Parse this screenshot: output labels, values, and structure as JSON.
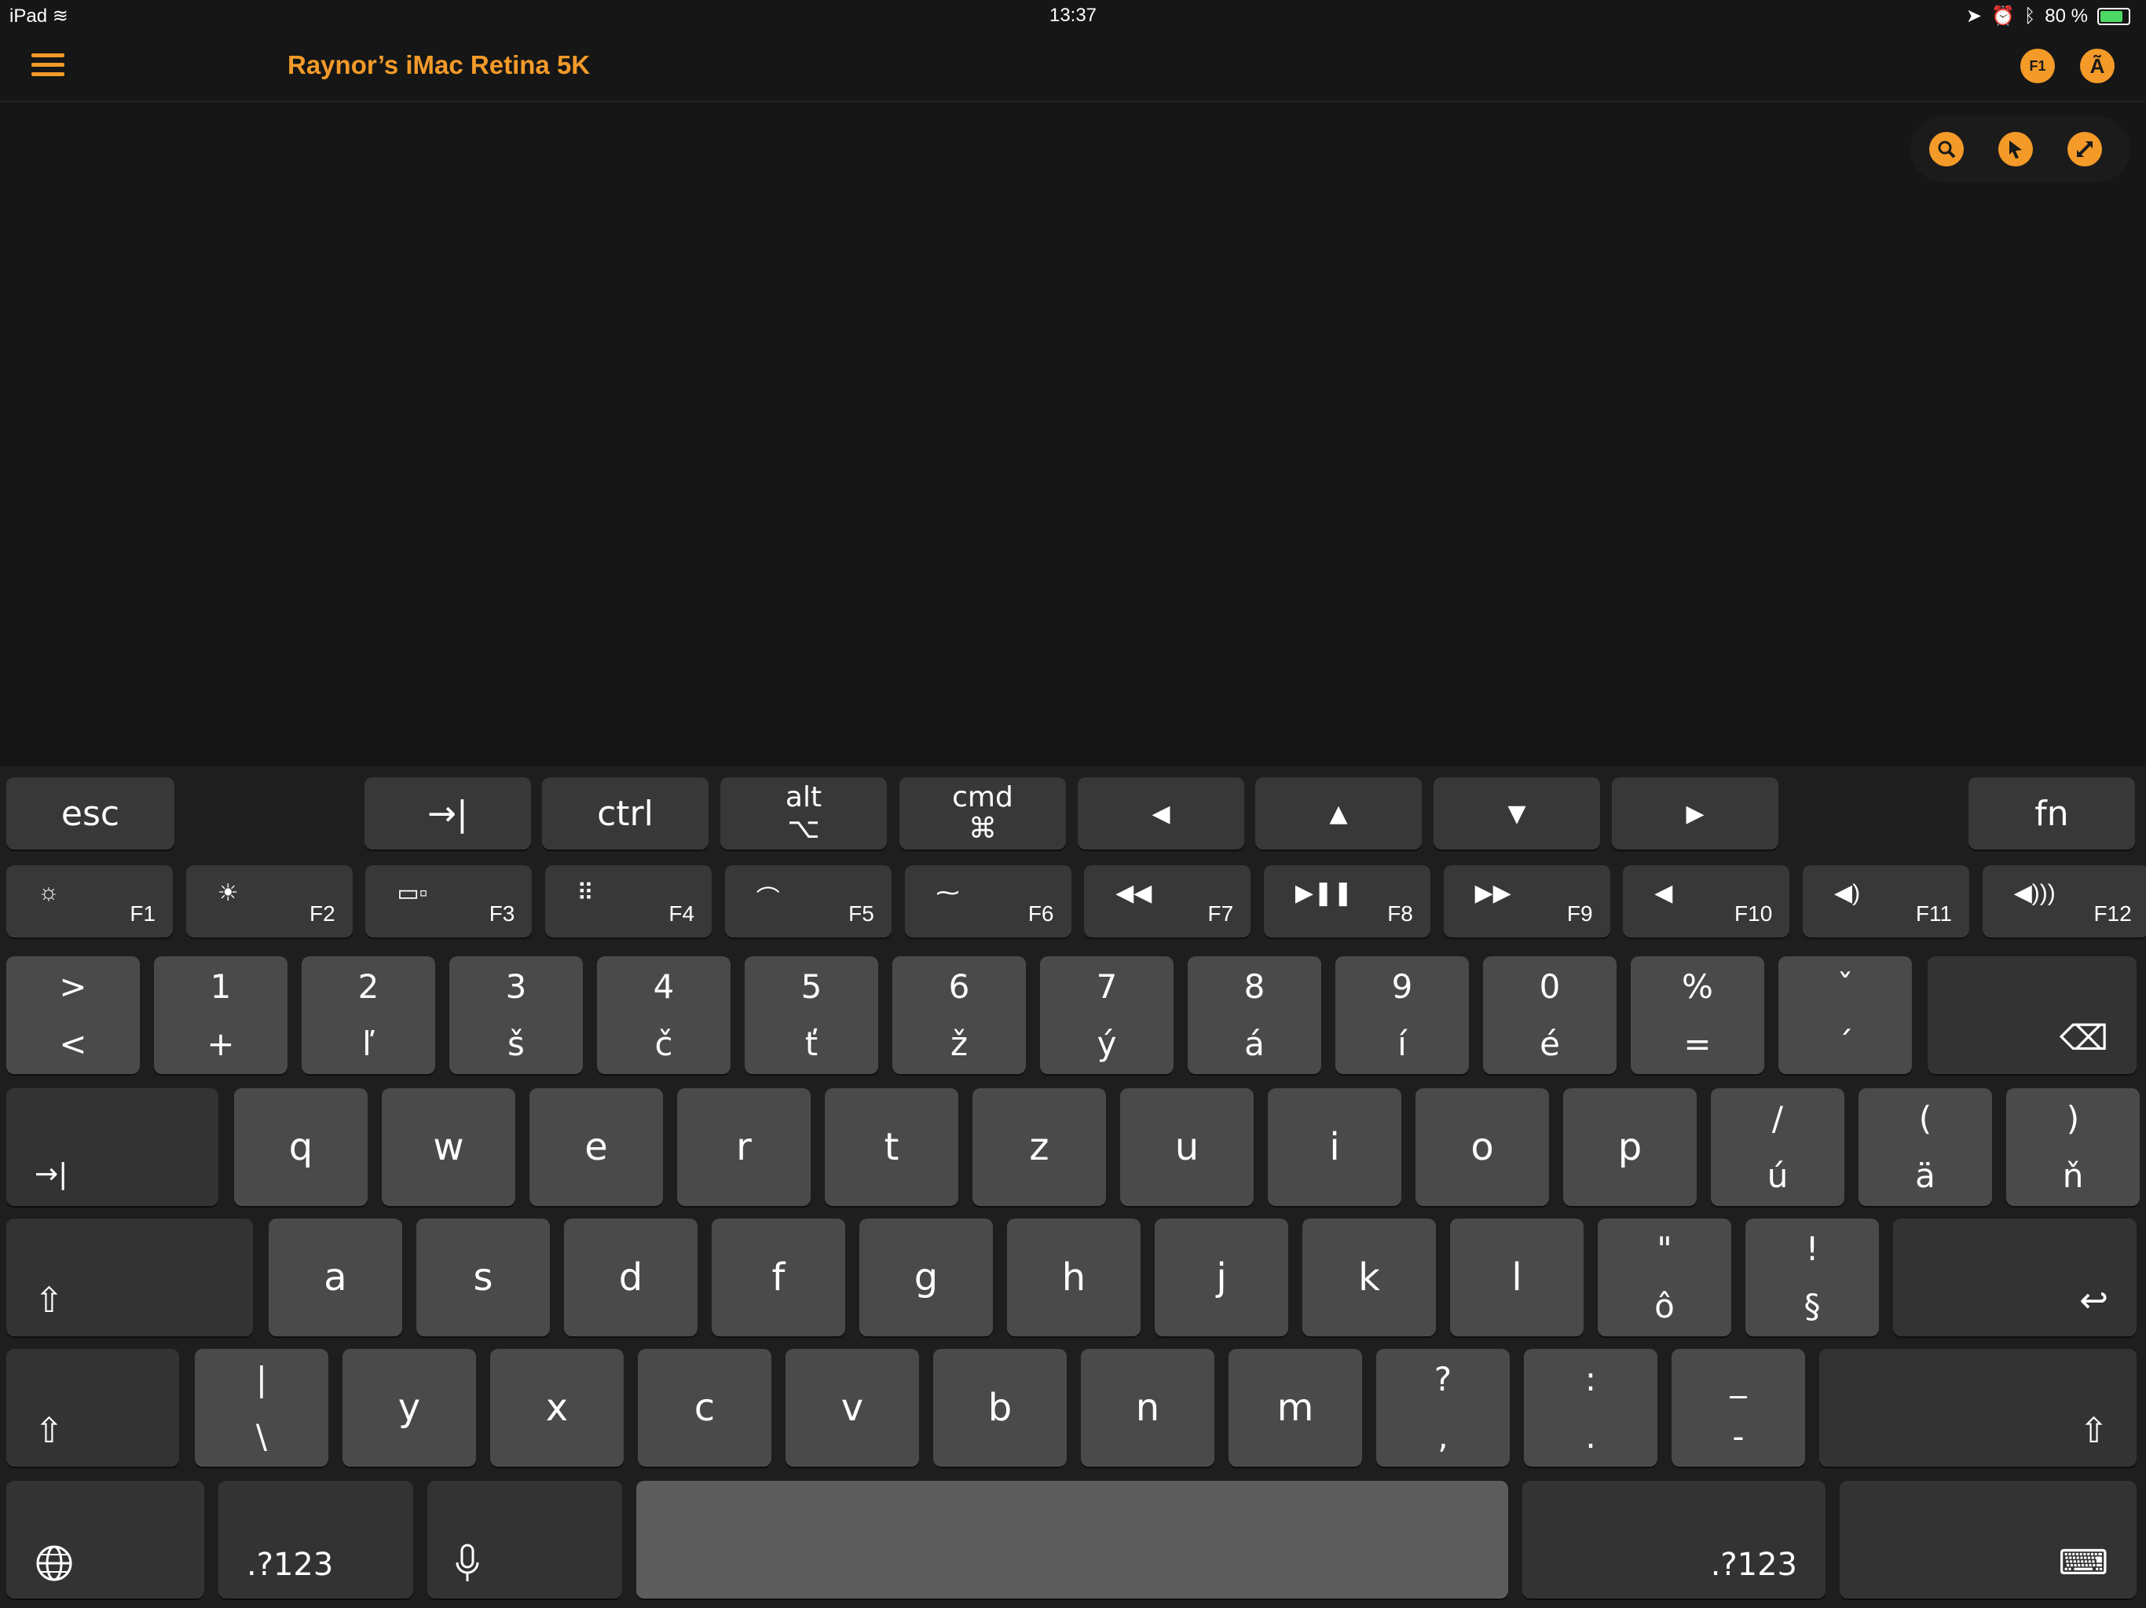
{
  "status": {
    "device": "iPad",
    "time": "13:37",
    "battery": "80 %",
    "battery_level": 0.8
  },
  "nav": {
    "title": "Raynor’s iMac Retina 5K",
    "f_label": "F1"
  },
  "mods": {
    "esc": "esc",
    "ctrl": "ctrl",
    "alt": "alt",
    "alt_sym": "⌥",
    "cmd": "cmd",
    "cmd_sym": "⌘",
    "fn": "fn",
    "left": "◀",
    "up": "▲",
    "down": "▼",
    "right": "▶",
    "tab": "→|"
  },
  "fkeys": [
    {
      "label": "F1",
      "icon": "brightness-down-icon",
      "glyph": "☼"
    },
    {
      "label": "F2",
      "icon": "brightness-up-icon",
      "glyph": "☀"
    },
    {
      "label": "F3",
      "icon": "mission-control-icon",
      "glyph": "▭▫"
    },
    {
      "label": "F4",
      "icon": "launchpad-icon",
      "glyph": "⠿"
    },
    {
      "label": "F5",
      "icon": "keyboard-light-down-icon",
      "glyph": "⌒"
    },
    {
      "label": "F6",
      "icon": "keyboard-light-up-icon",
      "glyph": "⁓"
    },
    {
      "label": "F7",
      "icon": "rewind-icon",
      "glyph": "◀◀"
    },
    {
      "label": "F8",
      "icon": "play-pause-icon",
      "glyph": "▶❚❚"
    },
    {
      "label": "F9",
      "icon": "fast-forward-icon",
      "glyph": "▶▶"
    },
    {
      "label": "F10",
      "icon": "mute-icon",
      "glyph": "◀"
    },
    {
      "label": "F11",
      "icon": "volume-down-icon",
      "glyph": "◀)"
    },
    {
      "label": "F12",
      "icon": "volume-up-icon",
      "glyph": "◀)))"
    }
  ],
  "row1": [
    {
      "top": ">",
      "bot": "<"
    },
    {
      "top": "1",
      "bot": "+"
    },
    {
      "top": "2",
      "bot": "ľ"
    },
    {
      "top": "3",
      "bot": "š"
    },
    {
      "top": "4",
      "bot": "č"
    },
    {
      "top": "5",
      "bot": "ť"
    },
    {
      "top": "6",
      "bot": "ž"
    },
    {
      "top": "7",
      "bot": "ý"
    },
    {
      "top": "8",
      "bot": "á"
    },
    {
      "top": "9",
      "bot": "í"
    },
    {
      "top": "0",
      "bot": "é"
    },
    {
      "top": "%",
      "bot": "="
    },
    {
      "top": "ˇ",
      "bot": "´"
    }
  ],
  "row2": [
    "q",
    "w",
    "e",
    "r",
    "t",
    "z",
    "u",
    "i",
    "o",
    "p"
  ],
  "row2_extra": [
    {
      "top": "/",
      "bot": "ú"
    },
    {
      "top": "(",
      "bot": "ä"
    },
    {
      "top": ")",
      "bot": "ň"
    }
  ],
  "row3": [
    "a",
    "s",
    "d",
    "f",
    "g",
    "h",
    "j",
    "k",
    "l"
  ],
  "row3_extra": [
    {
      "top": "\"",
      "bot": "ô"
    },
    {
      "top": "!",
      "bot": "§"
    }
  ],
  "row4_first": {
    "top": "|",
    "bot": "\\"
  },
  "row4": [
    "y",
    "x",
    "c",
    "v",
    "b",
    "n",
    "m"
  ],
  "row4_extra": [
    {
      "top": "?",
      "bot": ","
    },
    {
      "top": ":",
      "bot": "."
    },
    {
      "top": "_",
      "bot": "-"
    }
  ],
  "bottom": {
    "num_left": ".?123",
    "num_right": ".?123"
  },
  "glyphs": {
    "backspace": "⌫",
    "tab": "→|",
    "shift": "⇧",
    "return": "↩",
    "globe": "🌐",
    "mic": "🎙",
    "hide": "⌨",
    "menu": "≡"
  }
}
